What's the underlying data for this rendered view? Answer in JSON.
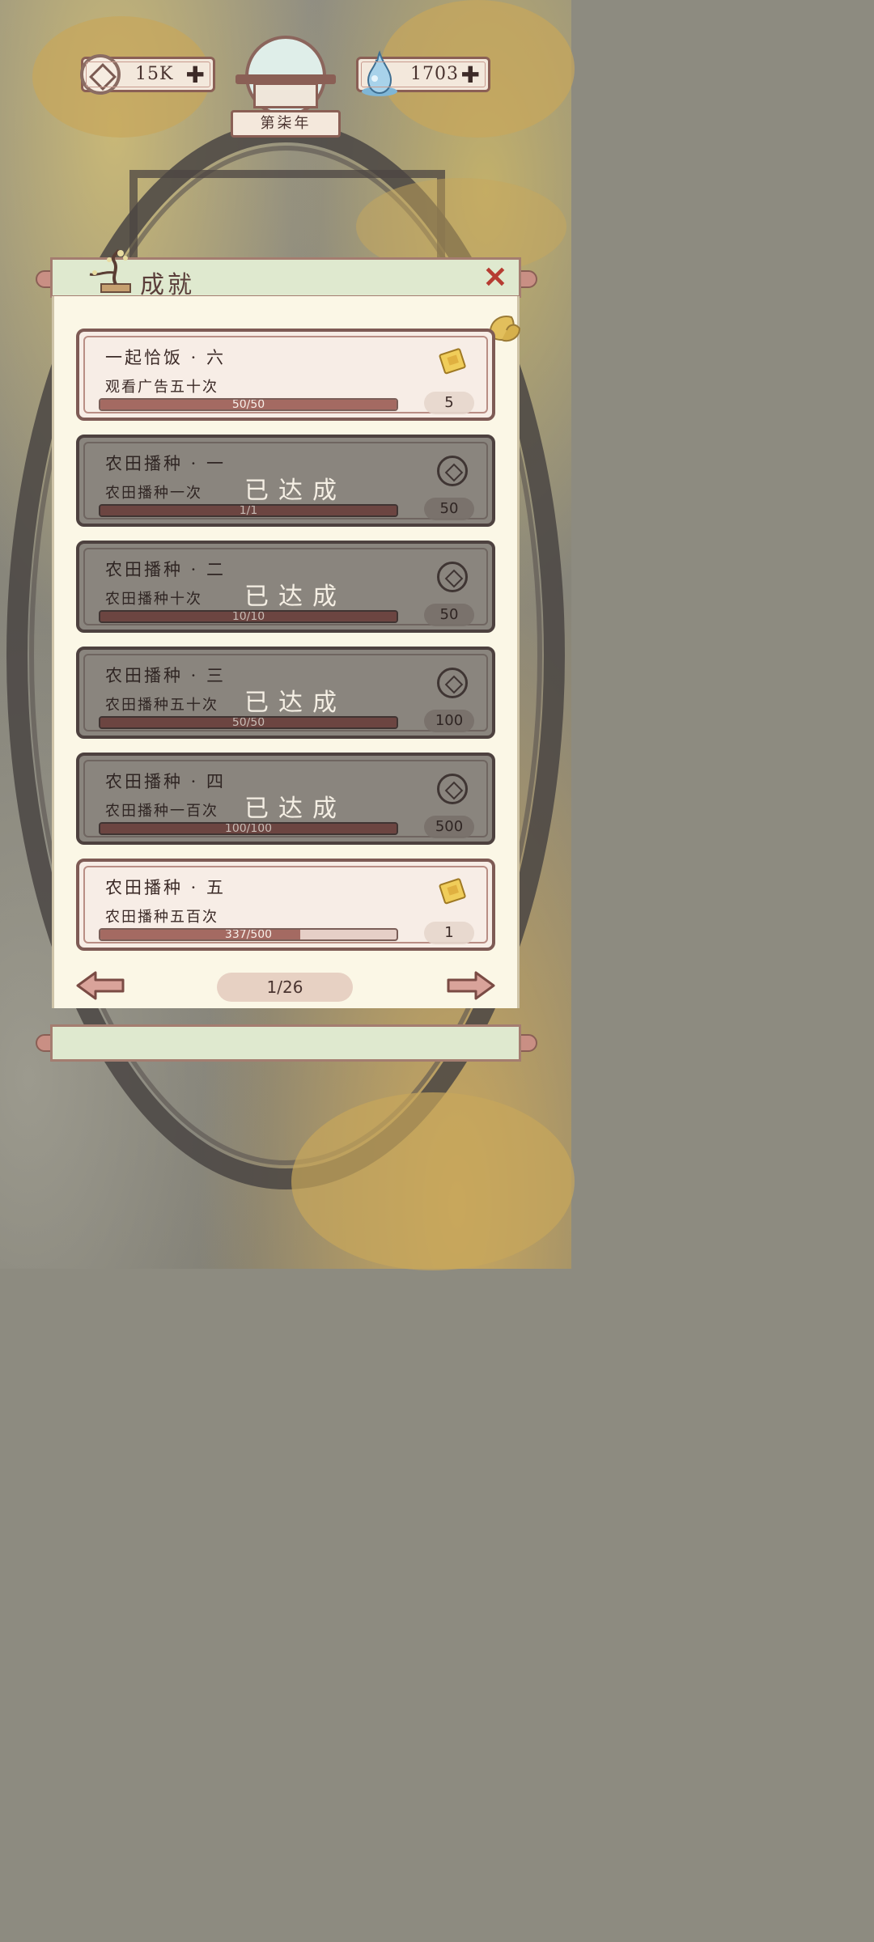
{
  "topbar": {
    "coins": "15K",
    "spirit": "1703",
    "year": "第柒年"
  },
  "panel": {
    "title": "成就"
  },
  "achievements": [
    {
      "name": "一起恰饭 · 六",
      "desc": "观看广告五十次",
      "progress": "50/50",
      "progress_fraction": 1.0,
      "reward": "5",
      "reward_icon": "ticket-icon",
      "done": false
    },
    {
      "name": "农田播种 · 一",
      "desc": "农田播种一次",
      "progress": "1/1",
      "progress_fraction": 1.0,
      "reward": "50",
      "reward_icon": "coin-icon",
      "done": true
    },
    {
      "name": "农田播种 · 二",
      "desc": "农田播种十次",
      "progress": "10/10",
      "progress_fraction": 1.0,
      "reward": "50",
      "reward_icon": "coin-icon",
      "done": true
    },
    {
      "name": "农田播种 · 三",
      "desc": "农田播种五十次",
      "progress": "50/50",
      "progress_fraction": 1.0,
      "reward": "100",
      "reward_icon": "coin-icon",
      "done": true
    },
    {
      "name": "农田播种 · 四",
      "desc": "农田播种一百次",
      "progress": "100/100",
      "progress_fraction": 1.0,
      "reward": "500",
      "reward_icon": "coin-icon",
      "done": true
    },
    {
      "name": "农田播种 · 五",
      "desc": "农田播种五百次",
      "progress": "337/500",
      "progress_fraction": 0.674,
      "reward": "1",
      "reward_icon": "ticket-icon",
      "done": false
    }
  ],
  "done_label": "已达成",
  "pager": {
    "page": "1/26"
  },
  "colors": {
    "accent_red": "#b63c32",
    "panel_green": "#dfe9cf",
    "card_border": "#7e5b55"
  }
}
